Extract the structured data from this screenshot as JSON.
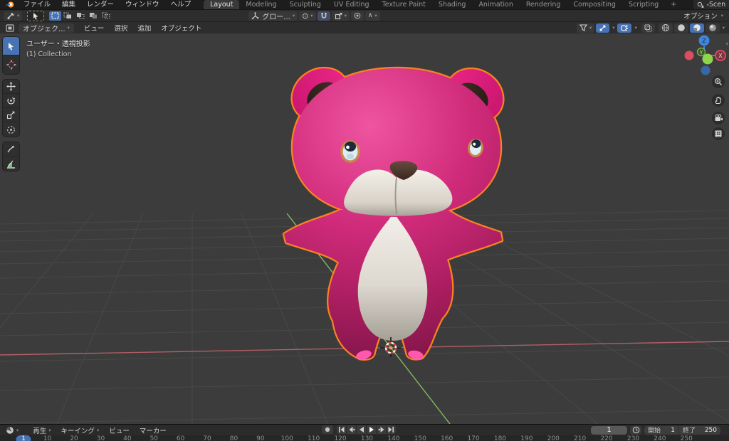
{
  "topbar": {
    "menus": [
      "ファイル",
      "編集",
      "レンダー",
      "ウィンドウ",
      "ヘルプ"
    ],
    "workspaces": [
      {
        "label": "Layout",
        "active": true
      },
      {
        "label": "Modeling"
      },
      {
        "label": "Sculpting"
      },
      {
        "label": "UV Editing"
      },
      {
        "label": "Texture Paint"
      },
      {
        "label": "Shading"
      },
      {
        "label": "Animation"
      },
      {
        "label": "Rendering"
      },
      {
        "label": "Compositing"
      },
      {
        "label": "Scripting"
      }
    ],
    "add_workspace": "+",
    "scene": "Scen"
  },
  "tool_header": {
    "orientation": "グロー...",
    "options": "オプション",
    "falloff": "∧",
    "pivot": "⊙"
  },
  "viewport_header": {
    "mode": "オブジェク...",
    "menus": [
      "ビュー",
      "選択",
      "追加",
      "オブジェクト"
    ]
  },
  "viewport": {
    "view_label": "ユーザー・透視投影",
    "collection": "(1) Collection",
    "axis_x": "X",
    "axis_y": "Y",
    "axis_z": "Z",
    "sidebar_toggle": "‹"
  },
  "timeline": {
    "menus": [
      {
        "label": "再生",
        "chev": true
      },
      {
        "label": "キーイング",
        "chev": true
      },
      {
        "label": "ビュー"
      },
      {
        "label": "マーカー"
      }
    ],
    "current_frame": "1",
    "start_label": "開始",
    "start_value": "1",
    "end_label": "終了",
    "end_value": "250",
    "playhead_frame": "1",
    "ruler_ticks": [
      "10",
      "20",
      "30",
      "40",
      "50",
      "60",
      "70",
      "80",
      "90",
      "100",
      "110",
      "120",
      "130",
      "140",
      "150",
      "160",
      "170",
      "180",
      "190",
      "200",
      "210",
      "220",
      "230",
      "240",
      "250"
    ]
  },
  "colors": {
    "accent_blue": "#4772b3",
    "selection_outline": "#fa8220",
    "bear_pink": "#d02b7b",
    "axis_x_red": "#b05f66",
    "axis_y_green": "#85b95e"
  }
}
